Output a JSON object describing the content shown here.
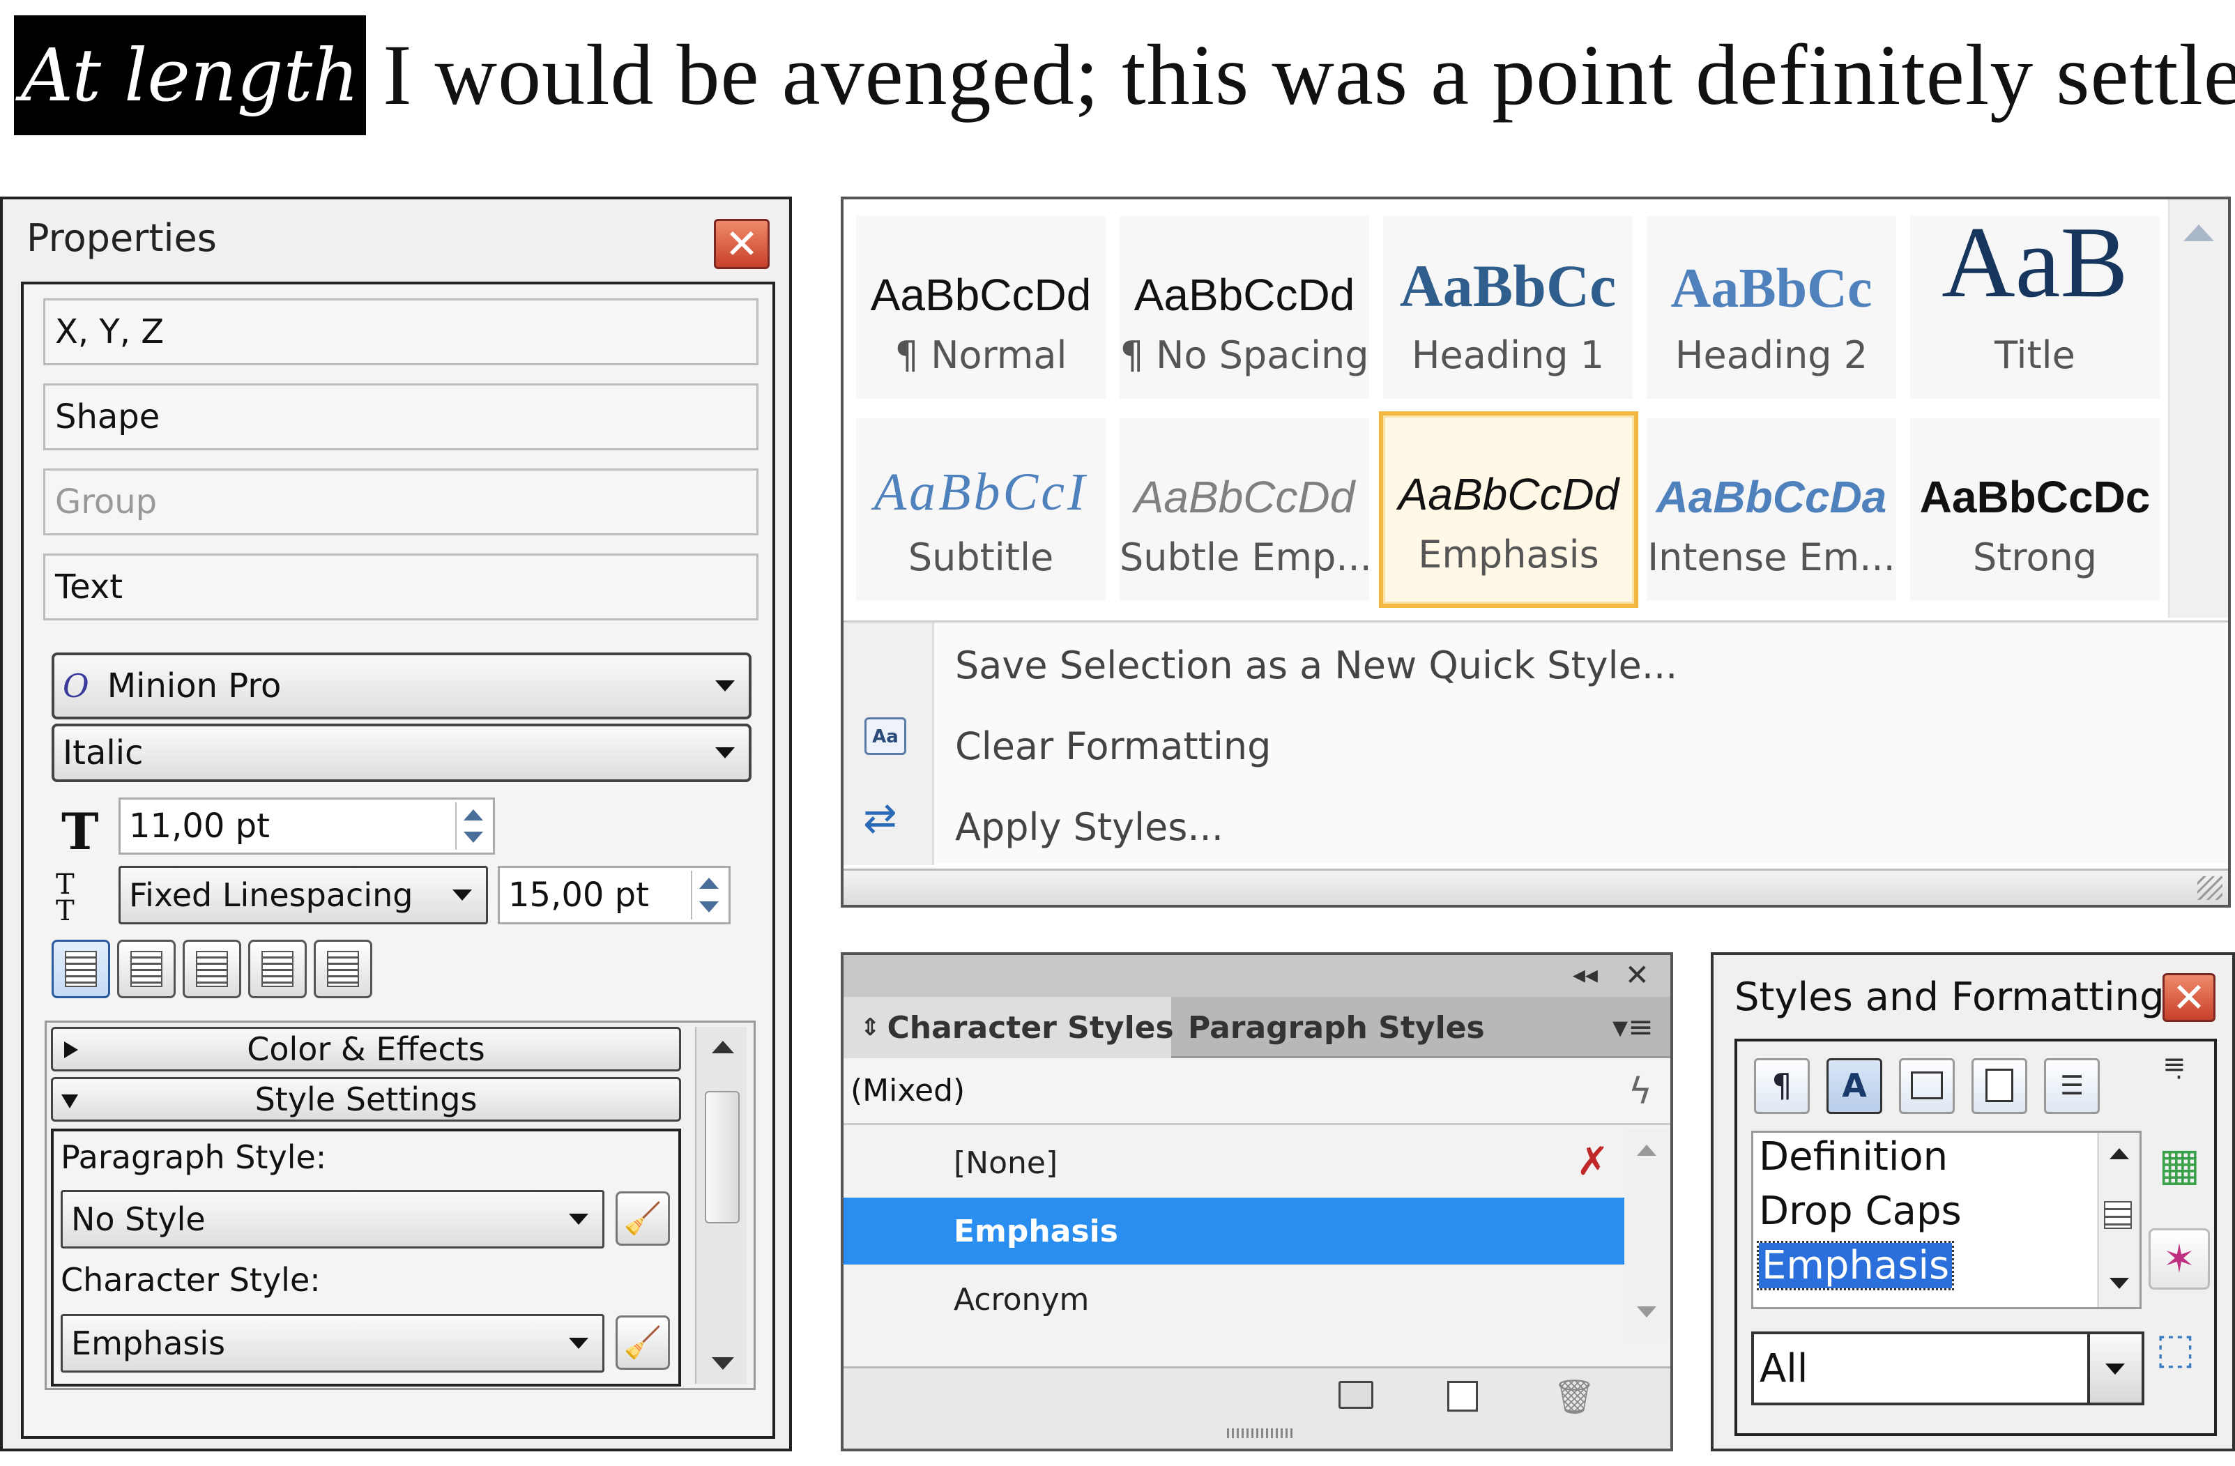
{
  "headline": {
    "highlight": "At length",
    "rest": "I would be avenged; this was a point definitely settled"
  },
  "properties": {
    "title": "Properties",
    "buttons": [
      "X, Y, Z",
      "Shape",
      "Group",
      "Text"
    ],
    "font_family": "Minion Pro",
    "font_style": "Italic",
    "font_size": "11,00 pt",
    "linespacing_mode": "Fixed Linespacing",
    "linespacing_value": "15,00 pt",
    "sections": {
      "color_effects": "Color & Effects",
      "style_settings": "Style Settings"
    },
    "paragraph_style_label": "Paragraph Style:",
    "paragraph_style_value": "No Style",
    "character_style_label": "Character Style:",
    "character_style_value": "Emphasis"
  },
  "quick_styles": {
    "tiles": [
      {
        "preview": "AaBbCcDd",
        "name": "¶ Normal"
      },
      {
        "preview": "AaBbCcDd",
        "name": "¶ No Spacing"
      },
      {
        "preview": "AaBbCc",
        "name": "Heading 1"
      },
      {
        "preview": "AaBbCc",
        "name": "Heading 2"
      },
      {
        "preview": "AaB",
        "name": "Title"
      },
      {
        "preview": "AaBbCcI",
        "name": "Subtitle"
      },
      {
        "preview": "AaBbCcDd",
        "name": "Subtle Emp..."
      },
      {
        "preview": "AaBbCcDd",
        "name": "Emphasis"
      },
      {
        "preview": "AaBbCcDa",
        "name": "Intense Em..."
      },
      {
        "preview": "AaBbCcDc",
        "name": "Strong"
      }
    ],
    "menu": [
      "Save Selection as a New Quick Style...",
      "Clear Formatting",
      "Apply Styles..."
    ]
  },
  "character_styles": {
    "tabs": [
      "Character Styles",
      "Paragraph Styles"
    ],
    "current": "(Mixed)",
    "items": [
      "[None]",
      "Emphasis",
      "Acronym"
    ],
    "selected": "Emphasis"
  },
  "styles_formatting": {
    "title": "Styles and Formatting",
    "items": [
      "Definition",
      "Drop Caps",
      "Emphasis"
    ],
    "filter": "All"
  },
  "colors": {
    "selection_blue": "#2a8ef0",
    "gallery_highlight": "#f4b942",
    "heading_blue": "#2f5d8c"
  }
}
